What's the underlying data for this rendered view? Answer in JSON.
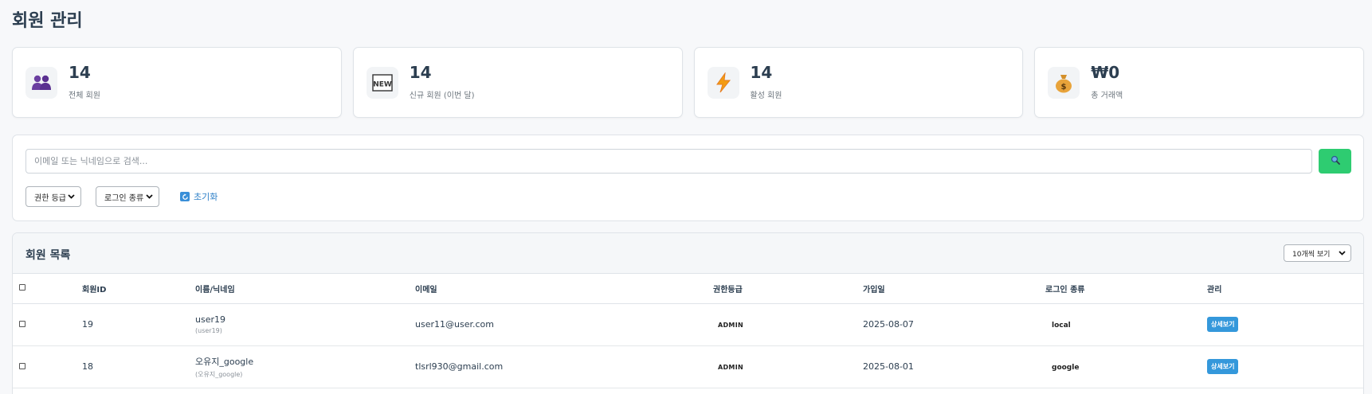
{
  "page_title": "회원 관리",
  "stats": [
    {
      "value": "14",
      "label": "전체 회원",
      "icon": "people-icon"
    },
    {
      "value": "14",
      "label": "신규 회원 (이번 달)",
      "icon": "new-icon"
    },
    {
      "value": "14",
      "label": "활성 회원",
      "icon": "lightning-icon"
    },
    {
      "value": "₩0",
      "label": "총 거래액",
      "icon": "money-bag-icon"
    }
  ],
  "search": {
    "placeholder": "이메일 또는 닉네임으로 검색...",
    "value": "",
    "button_icon": "search-icon"
  },
  "filters": {
    "role_select": "권한 등급",
    "login_select": "로그인 종류",
    "reset_label": "초기화"
  },
  "list": {
    "title": "회원 목록",
    "page_size": "10개씩 보기",
    "columns": [
      "회원ID",
      "이름/닉네임",
      "이메일",
      "권한등급",
      "가입일",
      "로그인 종류",
      "관리"
    ],
    "rows": [
      {
        "id": "19",
        "name": "user19",
        "nickname": "(user19)",
        "email": "user11@user.com",
        "role": "ADMIN",
        "joined": "2025-08-07",
        "login": "local",
        "action": "상세보기"
      },
      {
        "id": "18",
        "name": "오유지_google",
        "nickname": "(오유지_google)",
        "email": "tlsrl930@gmail.com",
        "role": "ADMIN",
        "joined": "2025-08-01",
        "login": "google",
        "action": "상세보기"
      }
    ]
  },
  "colors": {
    "search_button": "#2ecc71",
    "detail_button": "#3498db",
    "reset_link": "#2f80c8"
  }
}
